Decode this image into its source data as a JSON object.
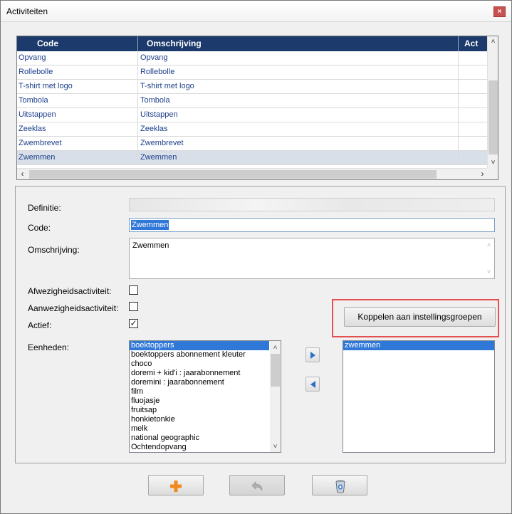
{
  "window": {
    "title": "Activiteiten",
    "close_label": "×"
  },
  "grid": {
    "columns": [
      "Code",
      "Omschrijving",
      "Act"
    ],
    "rows": [
      {
        "code": "Opvang",
        "desc": "Opvang"
      },
      {
        "code": "Rollebolle",
        "desc": "Rollebolle"
      },
      {
        "code": "T-shirt met logo",
        "desc": "T-shirt met logo"
      },
      {
        "code": "Tombola",
        "desc": "Tombola"
      },
      {
        "code": "Uitstappen",
        "desc": "Uitstappen"
      },
      {
        "code": "Zeeklas",
        "desc": "Zeeklas"
      },
      {
        "code": "Zwembrevet",
        "desc": "Zwembrevet"
      },
      {
        "code": "Zwemmen",
        "desc": "Zwemmen"
      }
    ],
    "selected_row": "Zwemmen"
  },
  "form": {
    "definitie_label": "Definitie:",
    "code_label": "Code:",
    "code_value": "Zwemmen",
    "omschrijving_label": "Omschrijving:",
    "omschrijving_value": "Zwemmen",
    "afwezigheid_label": "Afwezigheidsactiviteit:",
    "afwezigheid_checked": false,
    "aanwezigheid_label": "Aanwezigheidsactiviteit:",
    "aanwezigheid_checked": false,
    "actief_label": "Actief:",
    "actief_checked": true,
    "actief_mark": "✓",
    "eenheden_label": "Eenheden:",
    "koppelen_button": "Koppelen aan instellingsgroepen"
  },
  "available_units": [
    "boektoppers",
    "boektoppers abonnement kleuter",
    "choco",
    "doremi + kid'i : jaarabonnement",
    "doremini : jaarabonnement",
    "film",
    "fluojasje",
    "fruitsap",
    "honkietonkie",
    "melk",
    "national geographic",
    "Ochtendopvang"
  ],
  "selected_available_unit": "boektoppers",
  "assigned_units": [
    "zwemmen"
  ],
  "icons": {
    "add": "plus-icon",
    "undo": "undo-icon",
    "delete": "delete-icon"
  },
  "colors": {
    "header_bg": "#1c3a6b",
    "link_text": "#1d3f8a",
    "selection": "#3078d8",
    "highlight_box": "#e25050",
    "add_icon": "#f08a1c"
  }
}
